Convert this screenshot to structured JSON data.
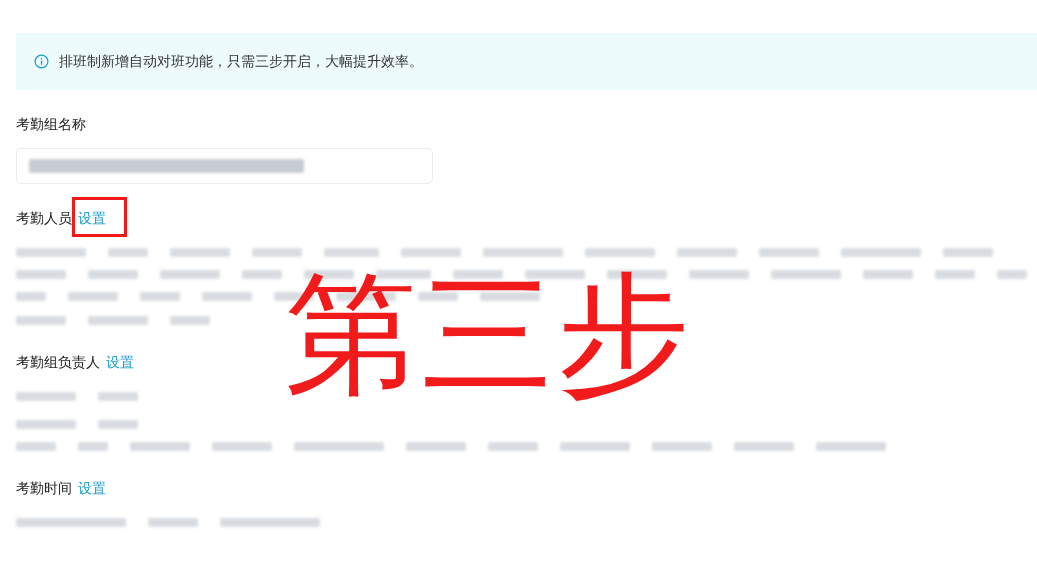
{
  "notice": {
    "text": "排班制新增自动对班功能，只需三步开启，大幅提升效率。"
  },
  "sections": [
    {
      "kind": "input",
      "label": "考勤组名称"
    },
    {
      "kind": "list",
      "label": "考勤人员",
      "link": "设置",
      "highlighted": true
    },
    {
      "kind": "list",
      "label": "考勤组负责人",
      "link": "设置",
      "highlighted": false
    },
    {
      "kind": "list",
      "label": "考勤时间",
      "link": "设置",
      "highlighted": false
    }
  ],
  "annotation": {
    "text": "第三步"
  }
}
